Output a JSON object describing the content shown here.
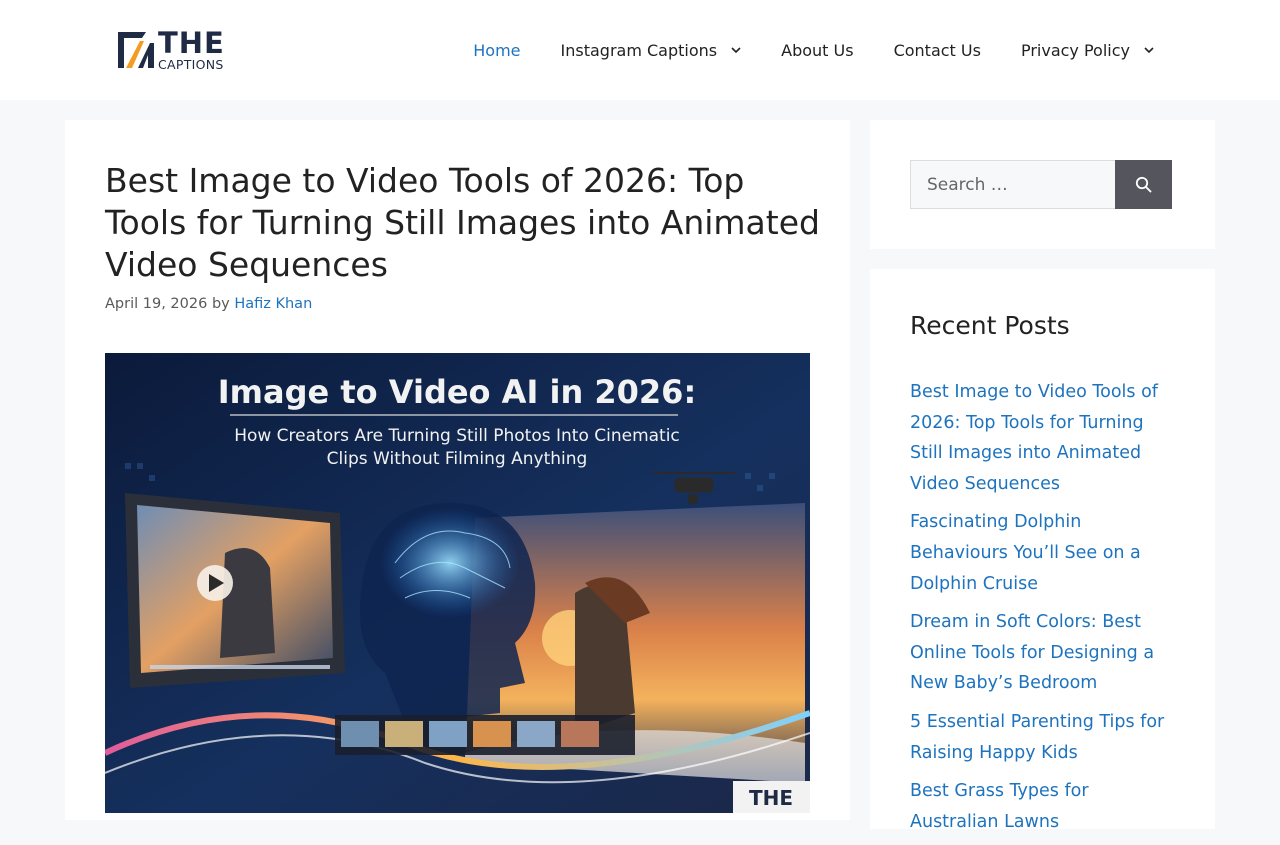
{
  "site": {
    "logo_title": "THE",
    "logo_subtitle": "CAPTIONS"
  },
  "nav": {
    "items": [
      {
        "label": "Home",
        "active": true,
        "dropdown": false
      },
      {
        "label": "Instagram Captions",
        "active": false,
        "dropdown": true
      },
      {
        "label": "About Us",
        "active": false,
        "dropdown": false
      },
      {
        "label": "Contact Us",
        "active": false,
        "dropdown": false
      },
      {
        "label": "Privacy Policy",
        "active": false,
        "dropdown": true
      }
    ]
  },
  "article": {
    "title": "Best Image to Video Tools of 2026: Top Tools for Turning Still Images into Animated Video Sequences",
    "date": "April 19, 2026",
    "by": "by",
    "author": "Hafiz Khan",
    "featured_image": {
      "headline": "Image to Video AI in 2026:",
      "subline_1": "How Creators Are Turning Still Photos Into Cinematic",
      "subline_2": "Clips Without Filming Anything"
    }
  },
  "sidebar": {
    "search": {
      "placeholder": "Search …",
      "icon": "search-icon"
    },
    "recent_posts": {
      "title": "Recent Posts",
      "items": [
        {
          "label": "Best Image to Video Tools of 2026: Top Tools for Turning Still Images into Animated Video Sequences"
        },
        {
          "label": "Fascinating Dolphin Behaviours You’ll See on a Dolphin Cruise"
        },
        {
          "label": "Dream in Soft Colors: Best Online Tools for Designing a New Baby’s Bedroom"
        },
        {
          "label": "5 Essential Parenting Tips for Raising Happy Kids"
        },
        {
          "label": "Best Grass Types for Australian Lawns"
        }
      ]
    }
  },
  "colors": {
    "link": "#1e73be",
    "search_button": "#55555e",
    "page_background": "#f7f8f9"
  }
}
